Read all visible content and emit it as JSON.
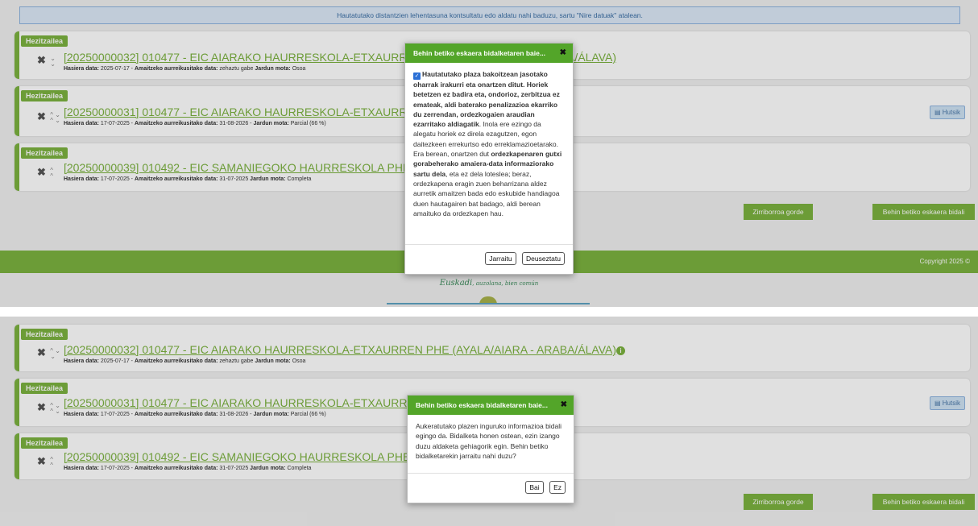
{
  "info_banner": "Hautatutako distantzien lehentasuna kontsultatu edo aldatu nahi baduzu, sartu \"Nire datuak\" atalean.",
  "cards": [
    {
      "badge": "Hezitzailea",
      "title": "[20250000032] 010477 - EIC AIARAKO HAURRESKOLA-ETXAURREN PHE (AYALA/AIARA - ARABA/ÁLAVA)",
      "start_label": "Hasiera data:",
      "start_value": "2025-07-17",
      "end_label": "Amaitzeko aurreikusitako data:",
      "end_value": "zehaztu gabe",
      "mode_label": "Jardun mota:",
      "mode_value": "Osoa"
    },
    {
      "badge": "Hezitzailea",
      "title": "[20250000031] 010477 - EIC AIARAKO HAURRESKOLA-ETXAURREN PHE (AYA",
      "start_label": "Hasiera data:",
      "start_value": "17-07-2025",
      "end_label": "Amaitzeko aurreikusitako data:",
      "end_value": "31-08-2026",
      "mode_label": "Jardun mota:",
      "mode_value": "Parcial (66 %)",
      "hutsik": "Hutsik"
    },
    {
      "badge": "Hezitzailea",
      "title": "[20250000039] 010492 - EIC SAMANIEGOKO HAURRESKOLA PHE (SAMANIEG",
      "start_label": "Hasiera data:",
      "start_value": "17-07-2025",
      "end_label": "Amaitzeko aurreikusitako data:",
      "end_value": "31-07-2025",
      "mode_label": "Jardun mota:",
      "mode_value": "Completa"
    }
  ],
  "icons": {
    "remove": "✖",
    "up": "≈",
    "info": "i",
    "file": "▤",
    "close": "✖"
  },
  "buttons": {
    "draft": "Zirriborroa gorde",
    "submit": "Behin betiko eskaera bidali"
  },
  "footer": {
    "copyright": "Copyright 2025 ©",
    "euskadi": "Euskadi",
    "euskadi_tag": ", auzolana, bien común"
  },
  "modal1": {
    "title": "Behin betiko eskaera bidalketaren baie...",
    "p1_bold": "Hautatutako plaza bakoitzean jasotako oharrak irakurri eta onartzen ditut. Horiek betetzen ez badira eta, ondorioz, zerbitzua ez emateak, aldi baterako penalizazioa ekarriko du zerrendan, ordezkogaien araudian ezarritako aldiagatik",
    "p1_rest": ". Inola ere ezingo da alegatu horiek ez direla ezagutzen, egon daitezkeen errekurtso edo erreklamazioetarako. Era berean, onartzen dut ",
    "p1_bold2": "ordezkapenaren gutxi gorabeherako amaiera-data informaziorako sartu dela",
    "p1_tail": ", eta ez dela loteslea; beraz, ordezkapena eragin zuen beharrizana aldez aurretik amaitzen bada edo eskubide handiagoa duen hautagairen bat badago, aldi berean amaituko da ordezkapen hau.",
    "btn_continue": "Jarraitu",
    "btn_cancel": "Deuseztatu"
  },
  "modal2": {
    "title": "Behin betiko eskaera bidalketaren baie...",
    "body": "Aukeratutako plazen inguruko informazioa bidali egingo da. Bidalketa honen ostean, ezin izango duzu aldaketa gehiagorik egin. Behin betiko bidalketarekin jarraitu nahi duzu?",
    "btn_yes": "Bai",
    "btn_no": "Ez"
  }
}
